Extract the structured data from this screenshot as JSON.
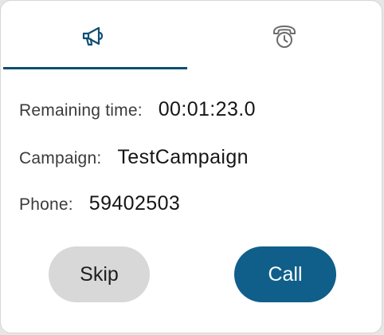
{
  "tabs": [
    {
      "icon": "megaphone-icon",
      "active": true
    },
    {
      "icon": "phone-clock-icon",
      "active": false
    }
  ],
  "fields": {
    "remaining_time_label": "Remaining time:",
    "remaining_time_value": "00:01:23.0",
    "campaign_label": "Campaign:",
    "campaign_value": "TestCampaign",
    "phone_label": "Phone:",
    "phone_value": "59402503"
  },
  "actions": {
    "skip_label": "Skip",
    "call_label": "Call"
  },
  "colors": {
    "accent": "#0e4f73",
    "call_button": "#0f5f8a",
    "skip_button": "#d8d8d8",
    "inactive_icon": "#6b6b6b"
  }
}
